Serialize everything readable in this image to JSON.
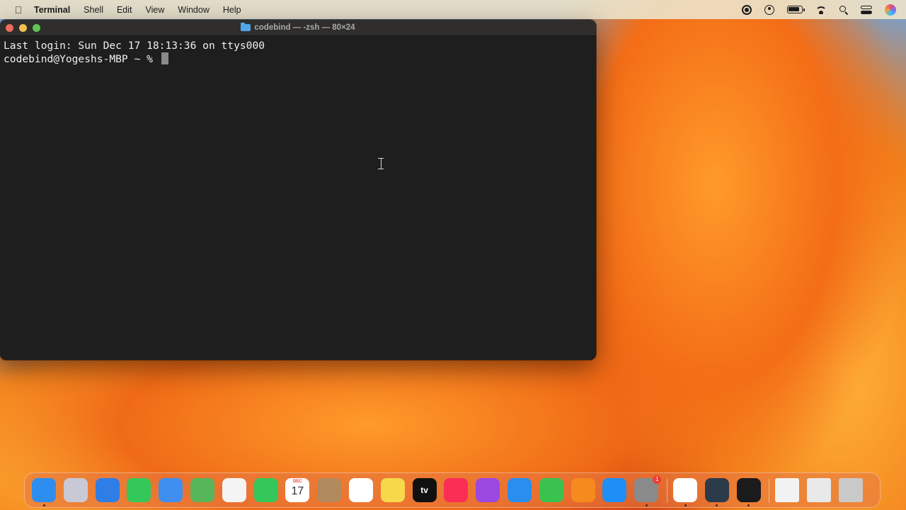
{
  "menubar": {
    "app_name": "Terminal",
    "menus": [
      "Shell",
      "Edit",
      "View",
      "Window",
      "Help"
    ],
    "status_icons": [
      "screen-record-icon",
      "user-icon",
      "battery-icon",
      "wifi-icon",
      "spotlight-search-icon",
      "control-center-icon",
      "siri-icon"
    ]
  },
  "terminal": {
    "title": "codebind — -zsh — 80×24",
    "lines": [
      "Last login: Sun Dec 17 18:13:36 on ttys000",
      "codebind@Yogeshs-MBP ~ % "
    ]
  },
  "dock": {
    "calendar": {
      "month": "DEC",
      "day": "17"
    },
    "appletv_label": "tv",
    "apps": [
      {
        "name": "finder",
        "color": "#2d8ef0",
        "running": true
      },
      {
        "name": "launchpad",
        "color": "#c9c9d6",
        "running": false
      },
      {
        "name": "safari",
        "color": "#2f7de6",
        "running": false
      },
      {
        "name": "messages",
        "color": "#34c759",
        "running": false
      },
      {
        "name": "mail",
        "color": "#3e8ff0",
        "running": false
      },
      {
        "name": "maps",
        "color": "#58b65a",
        "running": false
      },
      {
        "name": "photos",
        "color": "#f4f4f4",
        "running": false
      },
      {
        "name": "facetime",
        "color": "#34c759",
        "running": false
      },
      {
        "name": "calendar",
        "color": "#ffffff",
        "running": false
      },
      {
        "name": "contacts",
        "color": "#b08a5c",
        "running": false
      },
      {
        "name": "reminders",
        "color": "#ffffff",
        "running": false
      },
      {
        "name": "notes",
        "color": "#f7d84a",
        "running": false
      },
      {
        "name": "apple-tv",
        "color": "#111111",
        "running": false
      },
      {
        "name": "music",
        "color": "#fa2d55",
        "running": false
      },
      {
        "name": "podcasts",
        "color": "#9b48e0",
        "running": false
      },
      {
        "name": "keynote",
        "color": "#2a8df0",
        "running": false
      },
      {
        "name": "numbers",
        "color": "#3ac24f",
        "running": false
      },
      {
        "name": "pages",
        "color": "#f68a1f",
        "running": false
      },
      {
        "name": "app-store",
        "color": "#1f8ef5",
        "running": false
      },
      {
        "name": "system-settings",
        "color": "#8a8a8a",
        "running": true,
        "badge": "1"
      },
      {
        "name": "chrome",
        "color": "#ffffff",
        "running": true
      },
      {
        "name": "quicktime",
        "color": "#2b3b4a",
        "running": true
      },
      {
        "name": "terminal",
        "color": "#1b1b1b",
        "running": true
      },
      {
        "name": "document",
        "color": "#f2f2f2",
        "running": false
      },
      {
        "name": "screenshot-file",
        "color": "#e9e9e9",
        "running": false
      },
      {
        "name": "trash",
        "color": "#c9c9c9",
        "running": false
      }
    ]
  }
}
